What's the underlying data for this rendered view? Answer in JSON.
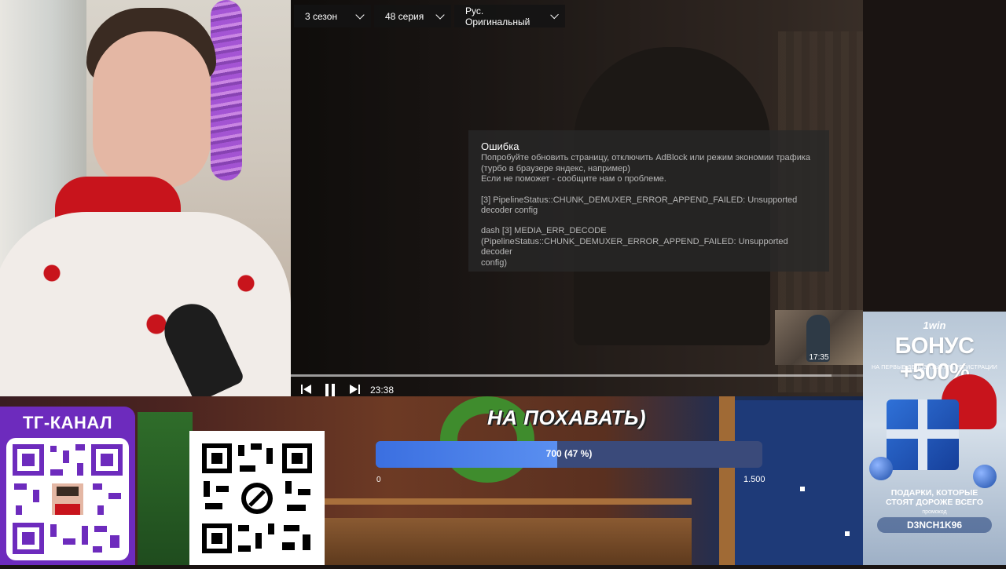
{
  "player": {
    "season_select": "3 сезон",
    "episode_select": "48 серия",
    "audio_select": "Рус. Оригинальный",
    "error": {
      "title": "Ошибка",
      "line1": "Попробуйте обновить страницу, отключить AdBlock или режим экономии трафика",
      "line2": "(турбо в браузере яндекс, например)",
      "line3": "Если не поможет - сообщите нам о проблеме.",
      "detail1": "[3] PipelineStatus::CHUNK_DEMUXER_ERROR_APPEND_FAILED: Unsupported",
      "detail2": "decoder config",
      "detail3": "dash [3] MEDIA_ERR_DECODE",
      "detail4": "(PipelineStatus::CHUNK_DEMUXER_ERROR_APPEND_FAILED: Unsupported decoder",
      "detail5": "config)"
    },
    "hover_time": "17:35",
    "current_time": "23:38",
    "icons": [
      "prev-icon",
      "pause-icon",
      "next-icon"
    ]
  },
  "stream": {
    "tg_title": "ТГ-КАНАЛ",
    "banner": "НА ПОХАВАТЬ)",
    "donation_text": "700 (47 %)",
    "donation_fraction": 0.47,
    "donation_min": "0",
    "donation_max": "1.500"
  },
  "ad": {
    "brand": "1win",
    "bonus": "БОНУС +500%",
    "sub": "НА ПЕРВЫЕ ДЕПОЗИТЫ ПРИ РЕГИСТРАЦИИ",
    "gifts_line1": "ПОДАРКИ, КОТОРЫЕ",
    "gifts_line2": "СТОЯТ ДОРОЖЕ ВСЕГО",
    "promo_label": "промокод",
    "promo": "D3NCH1K96"
  },
  "colors": {
    "tg_purple": "#6d2bbd",
    "donation_blue": "#3b6fe0"
  }
}
